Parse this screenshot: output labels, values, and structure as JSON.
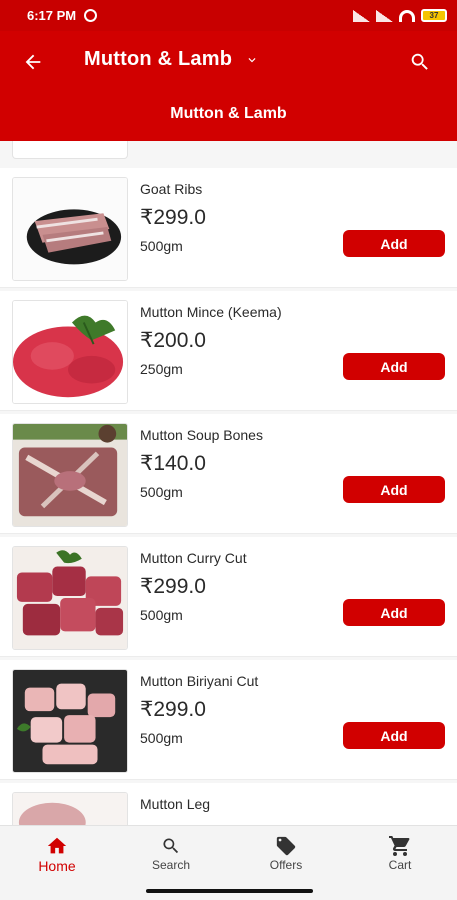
{
  "status_bar": {
    "time": "6:17 PM",
    "battery": "37"
  },
  "header": {
    "title": "Mutton & Lamb",
    "subtitle": "Mutton & Lamb"
  },
  "products": [
    {
      "name": "Goat Ribs",
      "price": "₹299.0",
      "qty": "500gm",
      "add_label": "Add"
    },
    {
      "name": "Mutton Mince (Keema)",
      "price": "₹200.0",
      "qty": "250gm",
      "add_label": "Add"
    },
    {
      "name": "Mutton Soup Bones",
      "price": "₹140.0",
      "qty": "500gm",
      "add_label": "Add"
    },
    {
      "name": "Mutton Curry Cut",
      "price": "₹299.0",
      "qty": "500gm",
      "add_label": "Add"
    },
    {
      "name": "Mutton Biriyani Cut",
      "price": "₹299.0",
      "qty": "500gm",
      "add_label": "Add"
    },
    {
      "name": "Mutton Leg"
    }
  ],
  "nav": {
    "home": "Home",
    "search": "Search",
    "offers": "Offers",
    "cart": "Cart"
  },
  "colors": {
    "brand": "#d10000",
    "status_bar": "#c80000"
  }
}
